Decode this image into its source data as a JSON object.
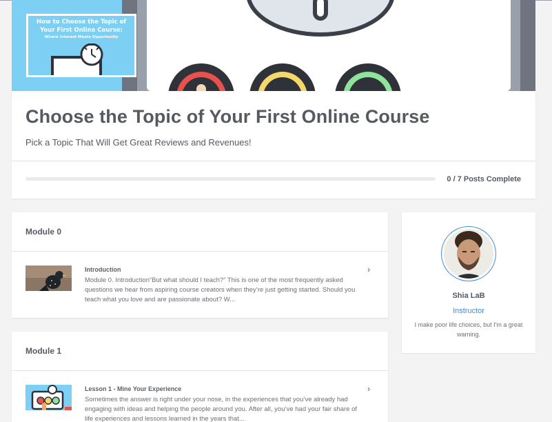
{
  "hero": {
    "thumbnail_title": "How to Choose the Topic of Your First Online Course:",
    "thumbnail_subtitle": "Where Interest Meets Opportunity"
  },
  "course": {
    "title": "Choose the Topic of Your First Online Course",
    "subtitle": "Pick a Topic That Will Get Great Reviews and Revenues!",
    "progress_fraction": 0,
    "progress_text": "0 / 7 Posts Complete"
  },
  "modules": [
    {
      "title": "Module 0",
      "post": {
        "title": "Introduction",
        "excerpt": "Module 0. Introduction“But what should I teach?” This is one of the most frequently asked questions we hear from aspiring course creators when they’re just getting started. Should you teach what you love and are passionate about? W..."
      }
    },
    {
      "title": "Module 1",
      "post": {
        "title": "Lesson 1 - Mine Your Experience",
        "excerpt": "Sometimes the answer is right under your nose, in the experiences that you’ve already had engaging with ideas and helping the people around you. After all, you’ve had your fair share of life experiences and lessons learned in the years that..."
      }
    }
  ],
  "instructor": {
    "name": "Shia LaB",
    "role": "Instructor",
    "bio": "I make poor life choices, but I'm a great warning."
  },
  "icons": {
    "chevron": "›"
  },
  "colors": {
    "accent": "#3c8dde",
    "hero_bg": "#7dcff3"
  }
}
